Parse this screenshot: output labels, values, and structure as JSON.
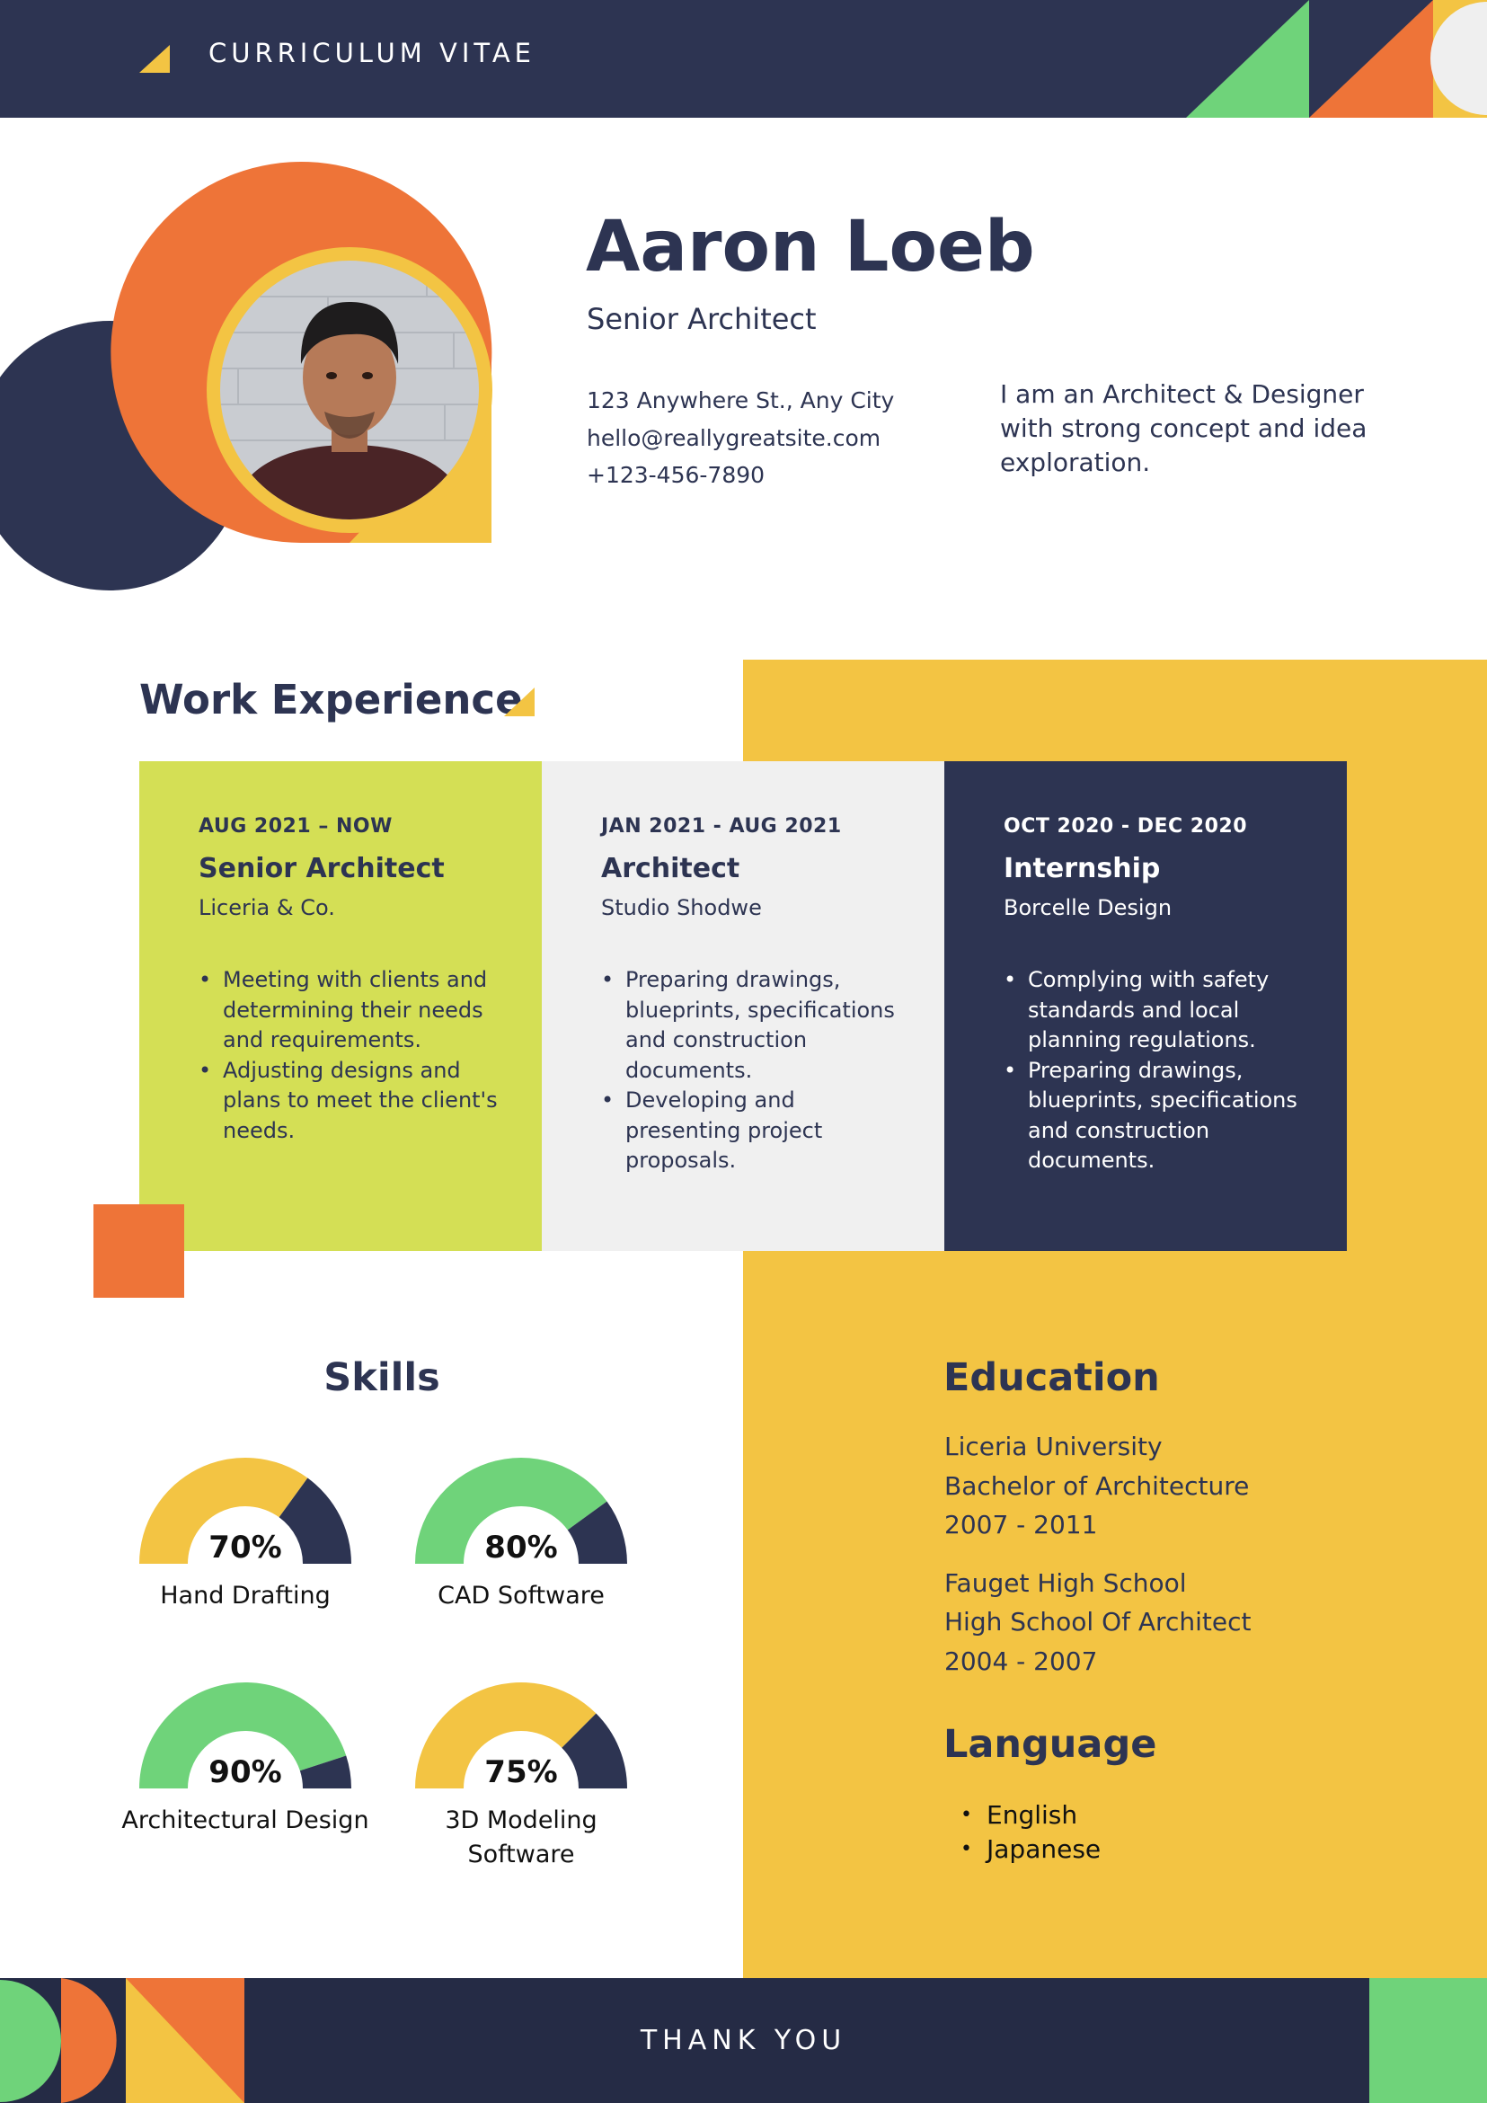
{
  "header": {
    "title": "CURRICULUM VITAE"
  },
  "profile": {
    "name": "Aaron Loeb",
    "title": "Senior Architect",
    "address": "123 Anywhere St., Any City",
    "email": "hello@reallygreatsite.com",
    "phone": "+123-456-7890",
    "about": "I am an Architect & Designer with strong concept and idea exploration."
  },
  "work_experience": {
    "heading": "Work Experience",
    "jobs": [
      {
        "date": "AUG 2021 – NOW",
        "role": "Senior Architect",
        "company": "Liceria & Co.",
        "duties": [
          "Meeting with clients and determining their needs and requirements.",
          "Adjusting designs and plans to meet the client's needs."
        ]
      },
      {
        "date": "JAN 2021 - AUG 2021",
        "role": "Architect",
        "company": "Studio Shodwe",
        "duties": [
          "Preparing drawings, blueprints, specifications and construction documents.",
          "Developing and presenting project proposals."
        ]
      },
      {
        "date": "OCT 2020 - DEC 2020",
        "role": "Internship",
        "company": "Borcelle Design",
        "duties": [
          "Complying with safety standards and local planning regulations.",
          "Preparing drawings, blueprints, specifications and construction documents."
        ]
      }
    ]
  },
  "skills": {
    "heading": "Skills",
    "items": [
      {
        "name": "Hand Drafting",
        "percent_label": "70%",
        "value": 70,
        "fill_color": "#f3c443"
      },
      {
        "name": "CAD Software",
        "percent_label": "80%",
        "value": 80,
        "fill_color": "#6fd37a"
      },
      {
        "name": "Architectural Design",
        "percent_label": "90%",
        "value": 90,
        "fill_color": "#6fd37a"
      },
      {
        "name": "3D Modeling Software",
        "percent_label": "75%",
        "value": 75,
        "fill_color": "#f3c443"
      }
    ],
    "remainder_color": "#2d3452"
  },
  "education": {
    "heading": "Education",
    "entries": [
      {
        "school": "Liceria University",
        "degree": "Bachelor of Architecture",
        "years": "2007 - 2011"
      },
      {
        "school": "Fauget High School",
        "degree": "High School Of Architect",
        "years": "2004 - 2007"
      }
    ]
  },
  "language": {
    "heading": "Language",
    "items": [
      "English",
      "Japanese"
    ]
  },
  "footer": {
    "text": "THANK YOU"
  },
  "colors": {
    "navy": "#2d3452",
    "orange": "#ee7438",
    "yellow": "#f3c443",
    "green": "#6fd37a",
    "lime": "#d4df55",
    "light_gray": "#f0f0f0"
  }
}
